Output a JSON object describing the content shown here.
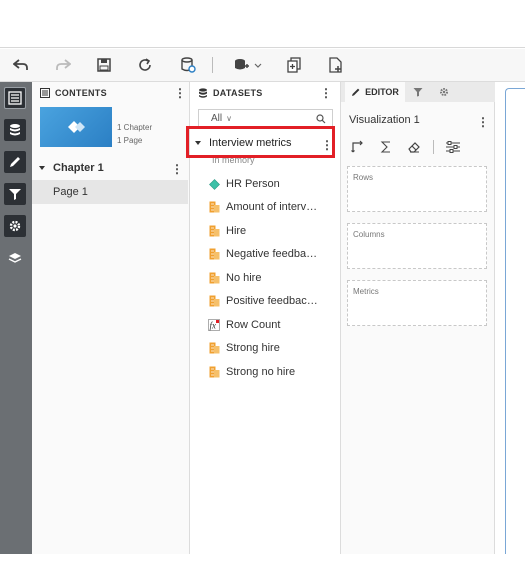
{
  "toolbar": {
    "icons": [
      "undo-icon",
      "redo-icon",
      "save-icon",
      "refresh-icon",
      "data-source-icon",
      "add-dataset-icon",
      "duplicate-page-icon",
      "new-page-icon"
    ]
  },
  "left_rail": {
    "icons": [
      "contents-icon",
      "datasets-icon",
      "editor-icon",
      "filter-icon",
      "settings-icon",
      "layers-icon"
    ]
  },
  "contents": {
    "title": "CONTENTS",
    "meta_chapter": "1 Chapter",
    "meta_page": "1 Page",
    "chapter_label": "Chapter 1",
    "page_label": "Page 1"
  },
  "datasets": {
    "title": "DATASETS",
    "filter_value": "All",
    "dataset_name": "Interview metrics",
    "dataset_sub": "In memory",
    "fields": [
      {
        "label": "HR Person",
        "icon": "attribute-icon"
      },
      {
        "label": "Amount of interv…",
        "icon": "metric-icon"
      },
      {
        "label": "Hire",
        "icon": "metric-icon"
      },
      {
        "label": "Negative feedba…",
        "icon": "metric-icon"
      },
      {
        "label": "No hire",
        "icon": "metric-icon"
      },
      {
        "label": "Positive feedbac…",
        "icon": "metric-icon"
      },
      {
        "label": "Row Count",
        "icon": "formula-icon"
      },
      {
        "label": "Strong hire",
        "icon": "metric-icon"
      },
      {
        "label": "Strong no hire",
        "icon": "metric-icon"
      }
    ]
  },
  "editor": {
    "tab_label": "EDITOR",
    "viz_title": "Visualization 1",
    "drop_rows": "Rows",
    "drop_columns": "Columns",
    "drop_metrics": "Metrics"
  },
  "colors": {
    "highlight": "#e21f26",
    "rail": "#6b6f73",
    "attribute": "#3cc1a8",
    "metric": "#f0a030"
  }
}
